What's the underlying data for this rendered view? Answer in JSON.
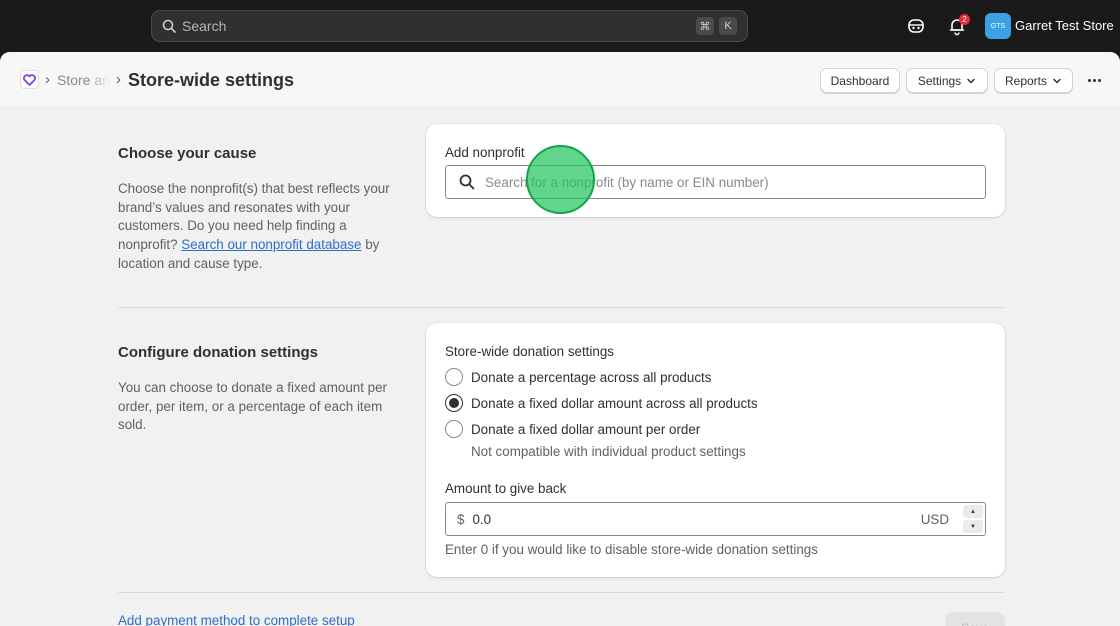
{
  "topbar": {
    "search_placeholder": "Search",
    "shortcut_keys": [
      "⌘",
      "K"
    ],
    "notification_count": "2",
    "avatar_initials": "GTS",
    "store_name": "Garret Test Store"
  },
  "header": {
    "breadcrumb_parent": "Store and product settings",
    "page_title": "Store-wide settings",
    "buttons": {
      "dashboard": "Dashboard",
      "settings": "Settings",
      "reports": "Reports"
    }
  },
  "cause_section": {
    "title": "Choose your cause",
    "description": "Choose the nonprofit(s) that best reflects your brand’s values and resonates with your customers. Do you need help finding a nonprofit?",
    "link_text": "Search our nonprofit database",
    "description_suffix": "by location and cause type.",
    "field_label": "Add nonprofit",
    "search_placeholder": "Search for a nonprofit (by name or EIN number)"
  },
  "donation_section": {
    "title": "Configure donation settings",
    "description": "You can choose to donate a fixed amount per order, per item, or a percentage of each item sold.",
    "group_label": "Store-wide donation settings",
    "options": [
      {
        "label": "Donate a percentage across all products",
        "selected": false
      },
      {
        "label": "Donate a fixed dollar amount across all products",
        "selected": true
      },
      {
        "label": "Donate a fixed dollar amount per order",
        "selected": false
      }
    ],
    "option_help": "Not compatible with individual product settings",
    "amount_label": "Amount to give back",
    "currency_prefix": "$",
    "amount_value": "0.0",
    "currency_suffix": "USD",
    "amount_help": "Enter 0 if you would like to disable store-wide donation settings"
  },
  "footer": {
    "setup_link": "Add payment method to complete setup",
    "save_button": "Save"
  },
  "colors": {
    "accent_link": "#2c6ecb",
    "badge": "#e22c38",
    "avatar": "#3ba2e8",
    "cursor_highlight": "#22c55e"
  }
}
